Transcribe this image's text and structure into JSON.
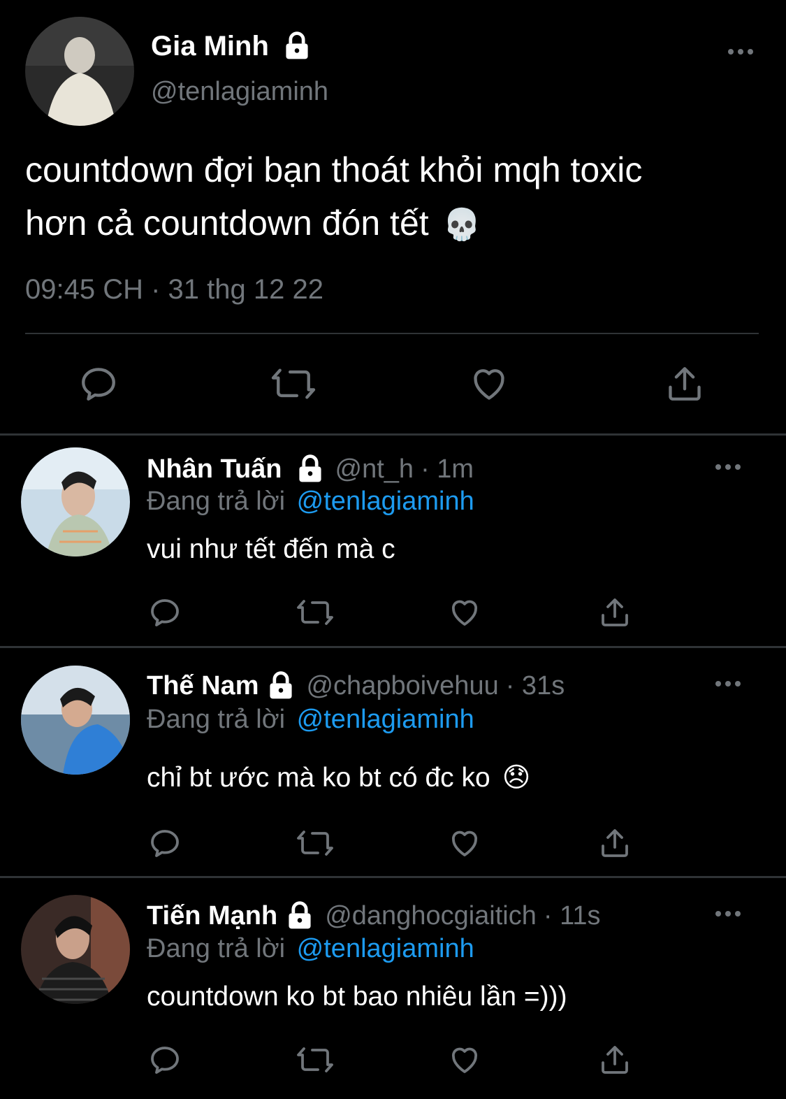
{
  "main_tweet": {
    "name": "Gia Minh",
    "handle": "@tenlagiaminh",
    "text_line1": "countdown đợi bạn thoát khỏi mqh toxic",
    "text_line2": "hơn cả countdown đón tết",
    "emoji": "💀",
    "timestamp": "09:45 CH · 31 thg 12 22",
    "more": "···"
  },
  "replies": [
    {
      "name": "Nhân Tuấn",
      "handle": "@nt_h",
      "time": "· 1m",
      "replying_prefix": "Đang trả lời",
      "replying_to": "@tenlagiaminh",
      "text": "vui như tết đến mà c",
      "emoji": "",
      "more": "···"
    },
    {
      "name": "Thế Nam",
      "handle": "@chapboivehuu",
      "time": "· 31s",
      "replying_prefix": "Đang trả lời",
      "replying_to": "@tenlagiaminh",
      "text": "chỉ bt ước mà ko bt có đc ko",
      "emoji": "😞",
      "more": "···"
    },
    {
      "name": "Tiến Mạnh",
      "handle": "@danghocgiaitich",
      "time": "· 11s",
      "replying_prefix": "Đang trả lời",
      "replying_to": "@tenlagiaminh",
      "text": "countdown ko bt bao nhiêu lần =)))",
      "emoji": "",
      "more": "···"
    }
  ],
  "icons": {
    "reply": "reply-icon",
    "retweet": "retweet-icon",
    "like": "heart-icon",
    "share": "share-icon",
    "lock": "lock-icon",
    "more": "more-icon"
  },
  "colors": {
    "background": "#000000",
    "text": "#e7e9ea",
    "secondary": "#71767b",
    "link": "#1d9bf0",
    "divider": "#2f3336"
  }
}
